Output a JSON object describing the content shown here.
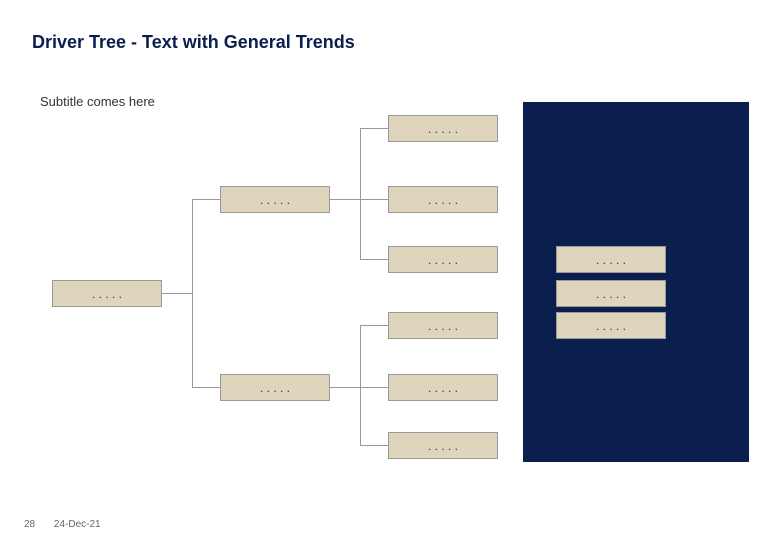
{
  "title": "Driver Tree - Text with General Trends",
  "subtitle": "Subtitle comes here",
  "boxes": {
    "root": ". . . . .",
    "b2a": ". . . . .",
    "b2b": ". . . . .",
    "c1": ". . . . .",
    "c2": ". . . . .",
    "c3": ". . . . .",
    "c4": ". . . . .",
    "c5": ". . . . .",
    "c6": ". . . . .",
    "d1": ". . . . .",
    "d2": ". . . . .",
    "d3": ". . . . ."
  },
  "footer": {
    "page": "28",
    "date": "24-Dec-21"
  },
  "colors": {
    "navy": "#0a1f4d",
    "tan": "#ded5bc"
  }
}
